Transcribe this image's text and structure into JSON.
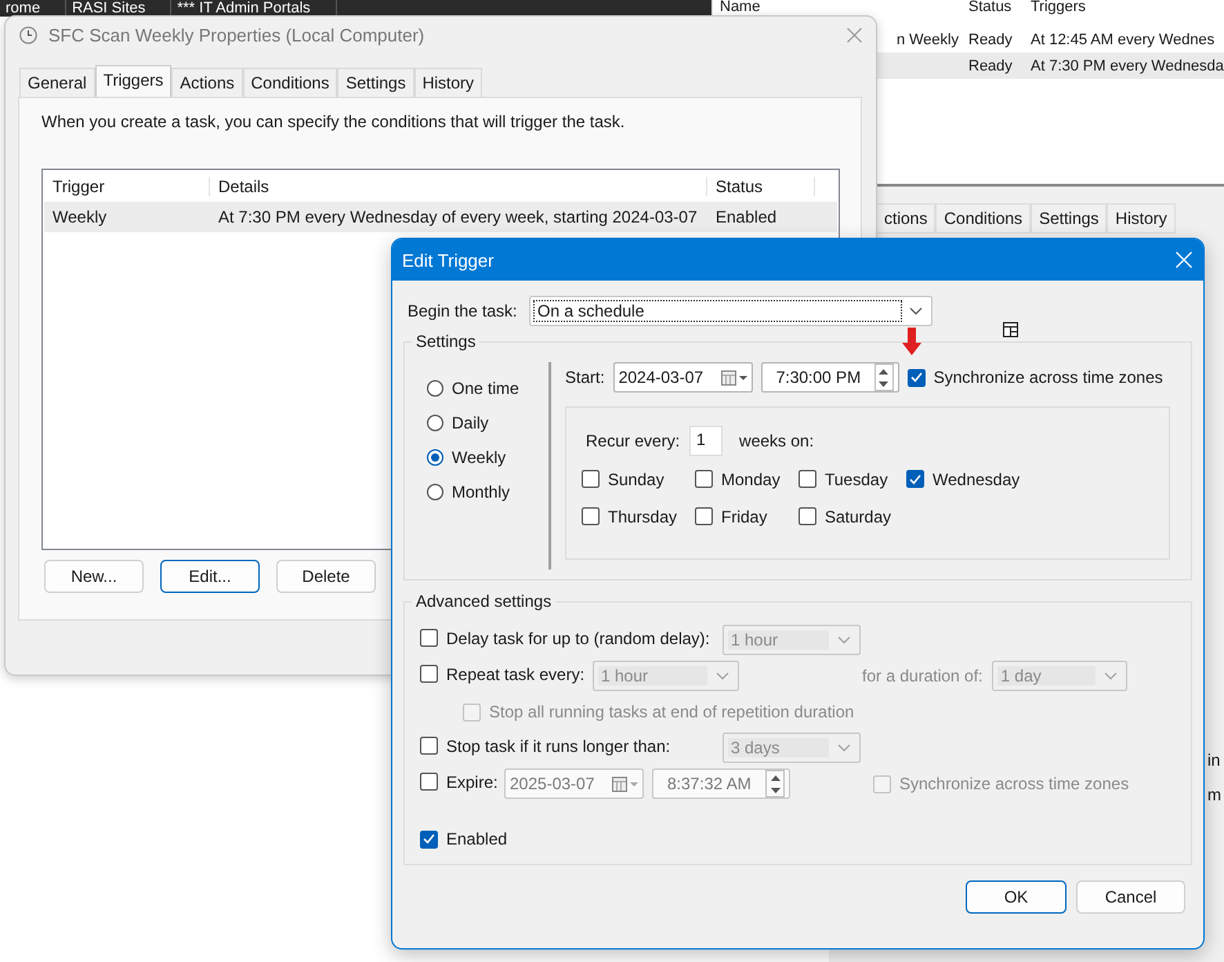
{
  "background": {
    "bookmarks": [
      "rome",
      "RASI Sites",
      "*** IT Admin Portals"
    ],
    "task_list": {
      "columns": [
        "Name",
        "Status",
        "Triggers"
      ],
      "rows": [
        {
          "name": "n Weekly",
          "status": "Ready",
          "triggers": "At 12:45 AM every Wednes",
          "selected": false
        },
        {
          "status": "Ready",
          "triggers": "At 7:30 PM every Wednesda",
          "selected": true
        }
      ]
    },
    "other_tabs": [
      "ctions",
      "Conditions",
      "Settings",
      "History"
    ],
    "edge_texts": [
      "in",
      "m"
    ]
  },
  "properties_window": {
    "title": "SFC Scan Weekly Properties (Local Computer)",
    "tabs": [
      {
        "label": "General",
        "selected": false
      },
      {
        "label": "Triggers",
        "selected": true
      },
      {
        "label": "Actions",
        "selected": false
      },
      {
        "label": "Conditions",
        "selected": false
      },
      {
        "label": "Settings",
        "selected": false
      },
      {
        "label": "History",
        "selected": false
      }
    ],
    "description": "When you create a task, you can specify the conditions that will trigger the task.",
    "table": {
      "columns": [
        "Trigger",
        "Details",
        "Status"
      ],
      "rows": [
        {
          "trigger": "Weekly",
          "details": "At 7:30 PM every Wednesday of every week, starting 2024-03-07",
          "status": "Enabled",
          "selected": true
        }
      ]
    },
    "buttons": [
      {
        "label": "New...",
        "focused": false
      },
      {
        "label": "Edit...",
        "focused": true
      },
      {
        "label": "Delete",
        "focused": false
      }
    ]
  },
  "edit_trigger": {
    "title": "Edit Trigger",
    "begin_label": "Begin the task:",
    "begin_value": "On a schedule",
    "settings_title": "Settings",
    "schedule": [
      {
        "label": "One time",
        "selected": false
      },
      {
        "label": "Daily",
        "selected": false
      },
      {
        "label": "Weekly",
        "selected": true
      },
      {
        "label": "Monthly",
        "selected": false
      }
    ],
    "start_label": "Start:",
    "start_date": "2024-03-07",
    "start_time": "7:30:00 PM",
    "sync": {
      "label": "Synchronize across time zones",
      "checked": true
    },
    "recur_label": "Recur every:",
    "recur_value": "1",
    "recur_suffix": "weeks on:",
    "days": [
      {
        "label": "Sunday",
        "checked": false
      },
      {
        "label": "Monday",
        "checked": false
      },
      {
        "label": "Tuesday",
        "checked": false
      },
      {
        "label": "Wednesday",
        "checked": true
      },
      {
        "label": "Thursday",
        "checked": false
      },
      {
        "label": "Friday",
        "checked": false
      },
      {
        "label": "Saturday",
        "checked": false
      }
    ],
    "advanced_title": "Advanced settings",
    "delay": {
      "label": "Delay task for up to (random delay):",
      "checked": false,
      "value": "1 hour"
    },
    "repeat": {
      "label": "Repeat task every:",
      "checked": false,
      "value": "1 hour",
      "duration_label": "for a duration of:",
      "duration_value": "1 day"
    },
    "stop_all": {
      "label": "Stop all running tasks at end of repetition duration",
      "checked": false
    },
    "stop_longer": {
      "label": "Stop task if it runs longer than:",
      "checked": false,
      "value": "3 days"
    },
    "expire": {
      "label": "Expire:",
      "checked": false,
      "date": "2025-03-07",
      "time": "8:37:32 AM",
      "sync_label": "Synchronize across time zones",
      "sync_checked": false
    },
    "enabled": {
      "label": "Enabled",
      "checked": true
    },
    "buttons": [
      {
        "label": "OK",
        "focused": true
      },
      {
        "label": "Cancel",
        "focused": false
      }
    ]
  }
}
